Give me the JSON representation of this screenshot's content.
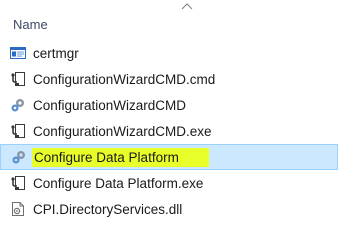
{
  "header": {
    "name_column": "Name",
    "sort_icon": "chevron-up-icon"
  },
  "files": [
    {
      "name": "certmgr",
      "icon": "msc-console-icon",
      "selected": false,
      "highlighted": false
    },
    {
      "name": "ConfigurationWizardCMD.cmd",
      "icon": "batch-file-icon",
      "selected": false,
      "highlighted": false
    },
    {
      "name": "ConfigurationWizardCMD",
      "icon": "gear-settings-icon",
      "selected": false,
      "highlighted": false
    },
    {
      "name": "ConfigurationWizardCMD.exe",
      "icon": "batch-file-icon",
      "selected": false,
      "highlighted": false
    },
    {
      "name": "Configure Data Platform",
      "icon": "gear-settings-icon",
      "selected": true,
      "highlighted": true
    },
    {
      "name": "Configure Data Platform.exe",
      "icon": "batch-file-icon",
      "selected": false,
      "highlighted": false
    },
    {
      "name": "CPI.DirectoryServices.dll",
      "icon": "dll-file-icon",
      "selected": false,
      "highlighted": false
    }
  ],
  "colors": {
    "selection_background": "#cce8ff",
    "selection_border": "#99d1ff",
    "marker_highlight": "#e9ff2a",
    "header_text": "#3d4a66"
  }
}
